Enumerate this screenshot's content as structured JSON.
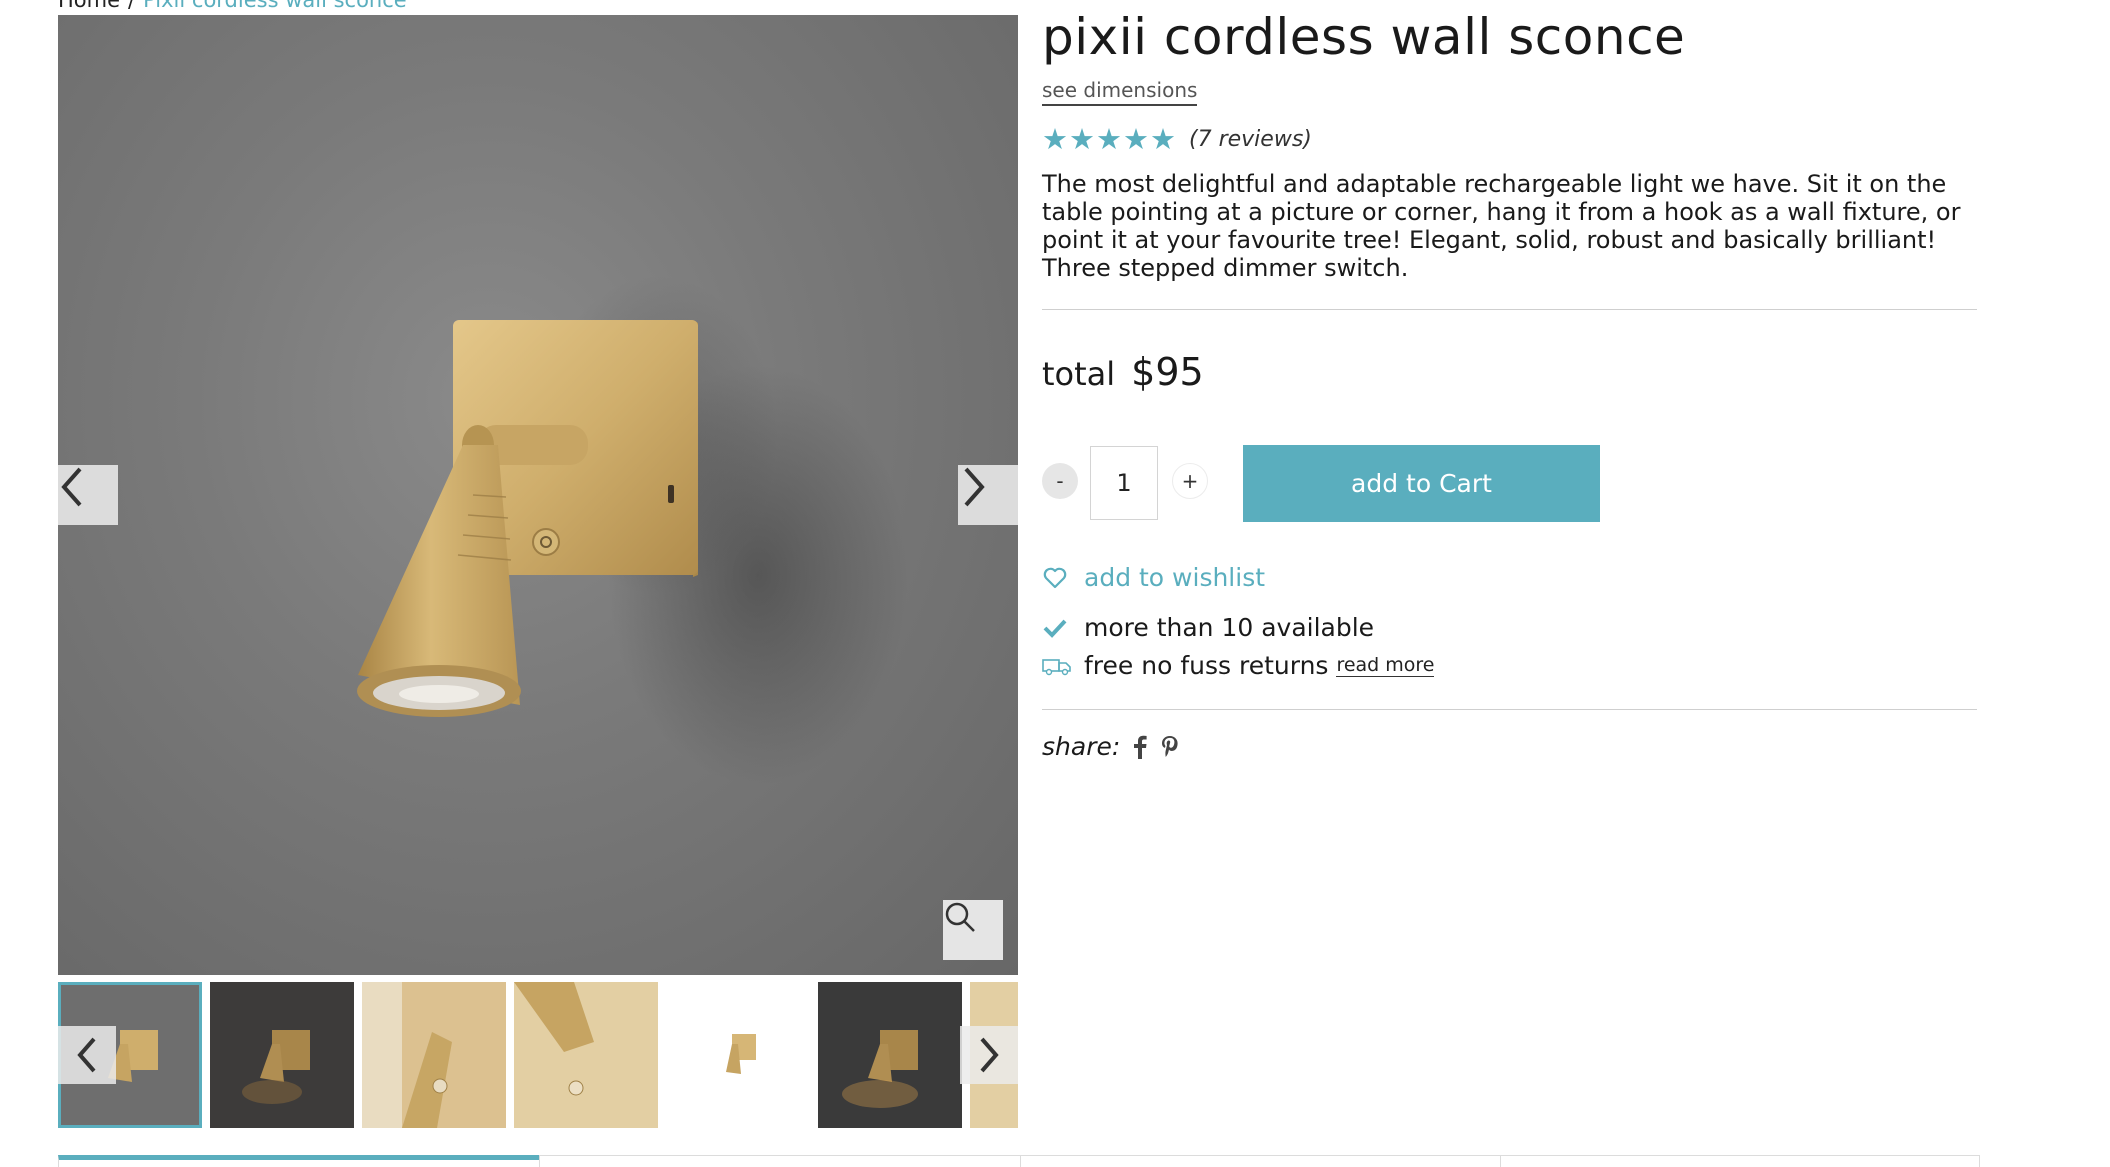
{
  "breadcrumb": {
    "home": "Home",
    "separator": "/",
    "current": "Pixii cordless wall sconce"
  },
  "product": {
    "title": "pixii cordless wall sconce",
    "see_dimensions": "see dimensions",
    "rating_stars": "★★★★★",
    "rating_value": 5,
    "reviews": "(7 reviews)",
    "description": "The most delightful and adaptable rechargeable light we have. Sit it on the table pointing at a picture or corner, hang it from a hook as a wall fixture, or point it at your favourite tree! Elegant, solid, robust and basically brilliant! Three stepped dimmer switch.",
    "total_label": "total",
    "price": "$95"
  },
  "purchase": {
    "minus": "-",
    "quantity": "1",
    "plus": "+",
    "add_to_cart": "add to Cart"
  },
  "info": {
    "wishlist": "add to wishlist",
    "availability": "more than 10 available",
    "returns": "free no fuss returns",
    "read_more": "read more"
  },
  "share": {
    "label": "share:"
  },
  "gallery": {
    "thumbnail_count": 7,
    "active_index": 0
  },
  "colors": {
    "accent": "#5aaebe",
    "wall_gray": "#777777",
    "brass": "#c9a45e"
  },
  "icons": [
    "chevron-left-icon",
    "chevron-right-icon",
    "search-icon",
    "heart-icon",
    "check-icon",
    "truck-icon",
    "facebook-icon",
    "pinterest-icon",
    "star-icon"
  ]
}
